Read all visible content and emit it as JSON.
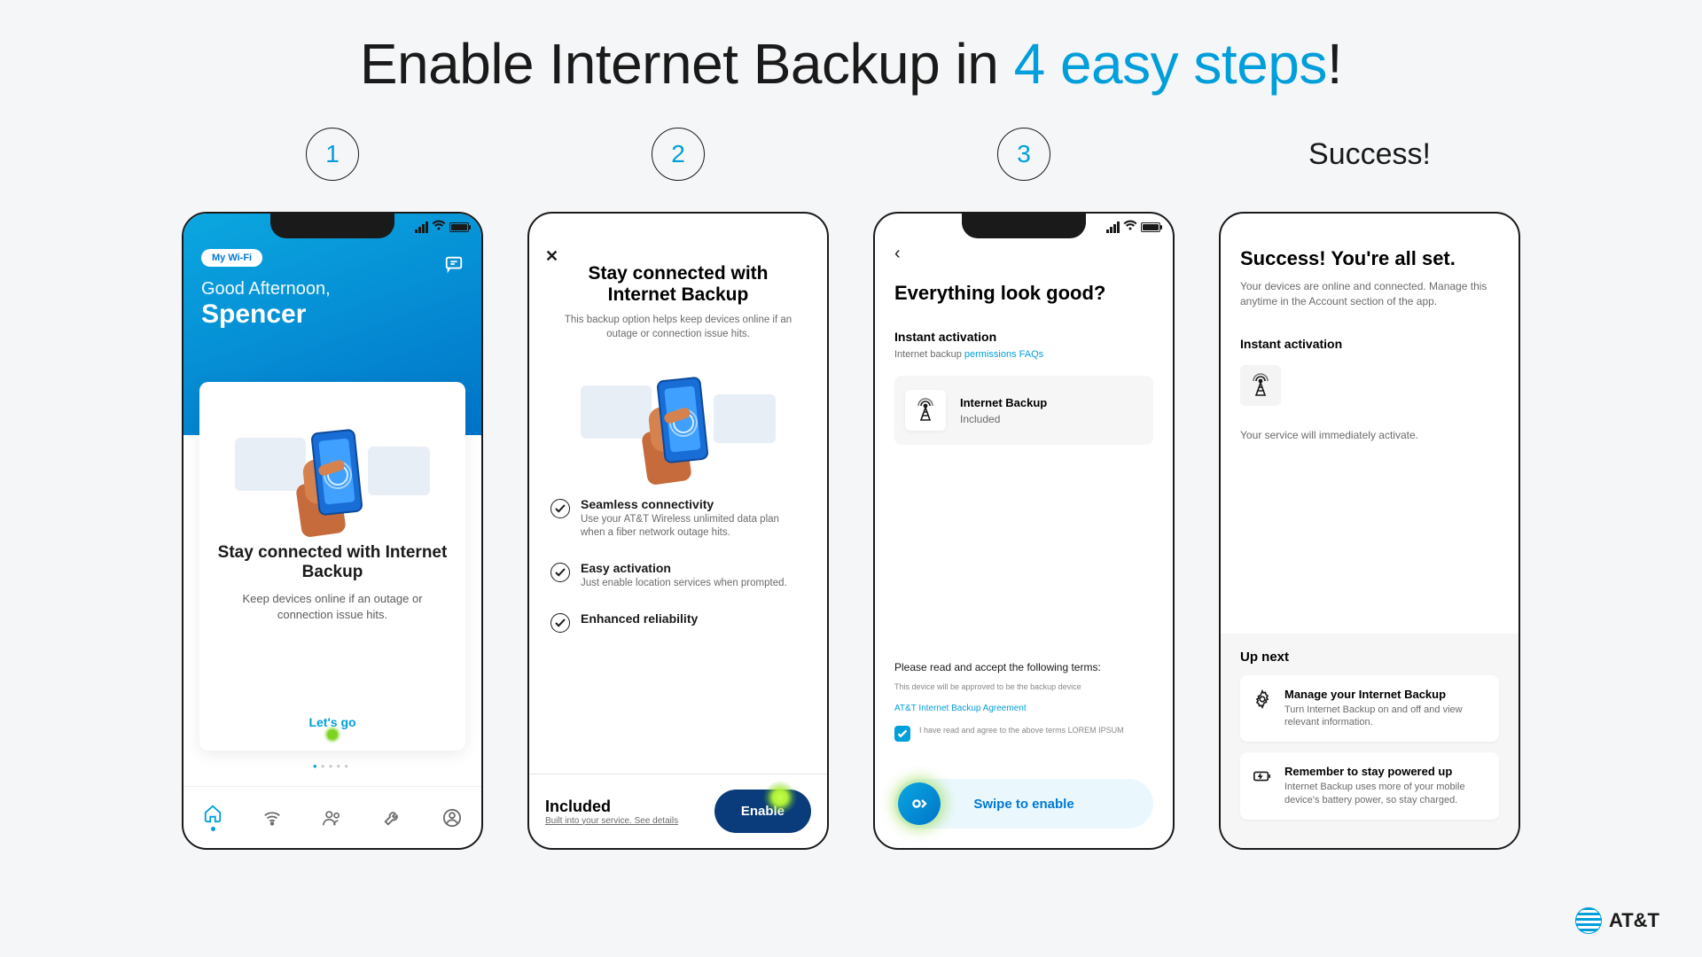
{
  "headline": {
    "pre": "Enable Internet Backup in ",
    "accent": "4 easy steps",
    "post": "!"
  },
  "steps": {
    "s1": "1",
    "s2": "2",
    "s3": "3",
    "s4": "Success!"
  },
  "screen1": {
    "pill": "My Wi-Fi",
    "greeting": "Good Afternoon,",
    "name": "Spencer",
    "card_title": "Stay connected with Internet Backup",
    "card_body": "Keep devices online if an outage or connection issue hits.",
    "cta": "Let's go"
  },
  "screen2": {
    "title1": "Stay connected with",
    "title2": "Internet Backup",
    "sub": "This backup option helps keep devices online if an outage or connection issue hits.",
    "feat1_t": "Seamless connectivity",
    "feat1_b": "Use your AT&T Wireless unlimited data plan when a fiber network outage hits.",
    "feat2_t": "Easy activation",
    "feat2_b": "Just enable location services when prompted.",
    "feat3_t": "Enhanced reliability",
    "included": "Included",
    "see_details_pre": "Built into your service. ",
    "see_details_link": "See details",
    "enable": "Enable"
  },
  "screen3": {
    "title": "Everything look good?",
    "section": "Instant activation",
    "faq_pre": "Internet backup ",
    "faq_link": "permissions FAQs",
    "box_t": "Internet Backup",
    "box_b": "Included",
    "terms_h": "Please read and accept the following terms:",
    "terms_b": "This device will be approved to be the backup device",
    "agreement_link": "AT&T Internet Backup Agreement",
    "check_txt": "I have read and agree to the above terms LOREM IPSUM",
    "swipe": "Swipe to enable"
  },
  "screen4": {
    "title": "Success! You're all set.",
    "sub": "Your devices are online and connected. Manage this anytime in the Account section of the app.",
    "section": "Instant activation",
    "note": "Your service will immediately activate.",
    "upnext": "Up next",
    "card1_t": "Manage your Internet Backup",
    "card1_b": "Turn Internet Backup on and off and view relevant information.",
    "card2_t": "Remember to stay powered up",
    "card2_b": "Internet Backup uses more of your mobile device's battery power, so stay charged."
  },
  "brand": "AT&T"
}
